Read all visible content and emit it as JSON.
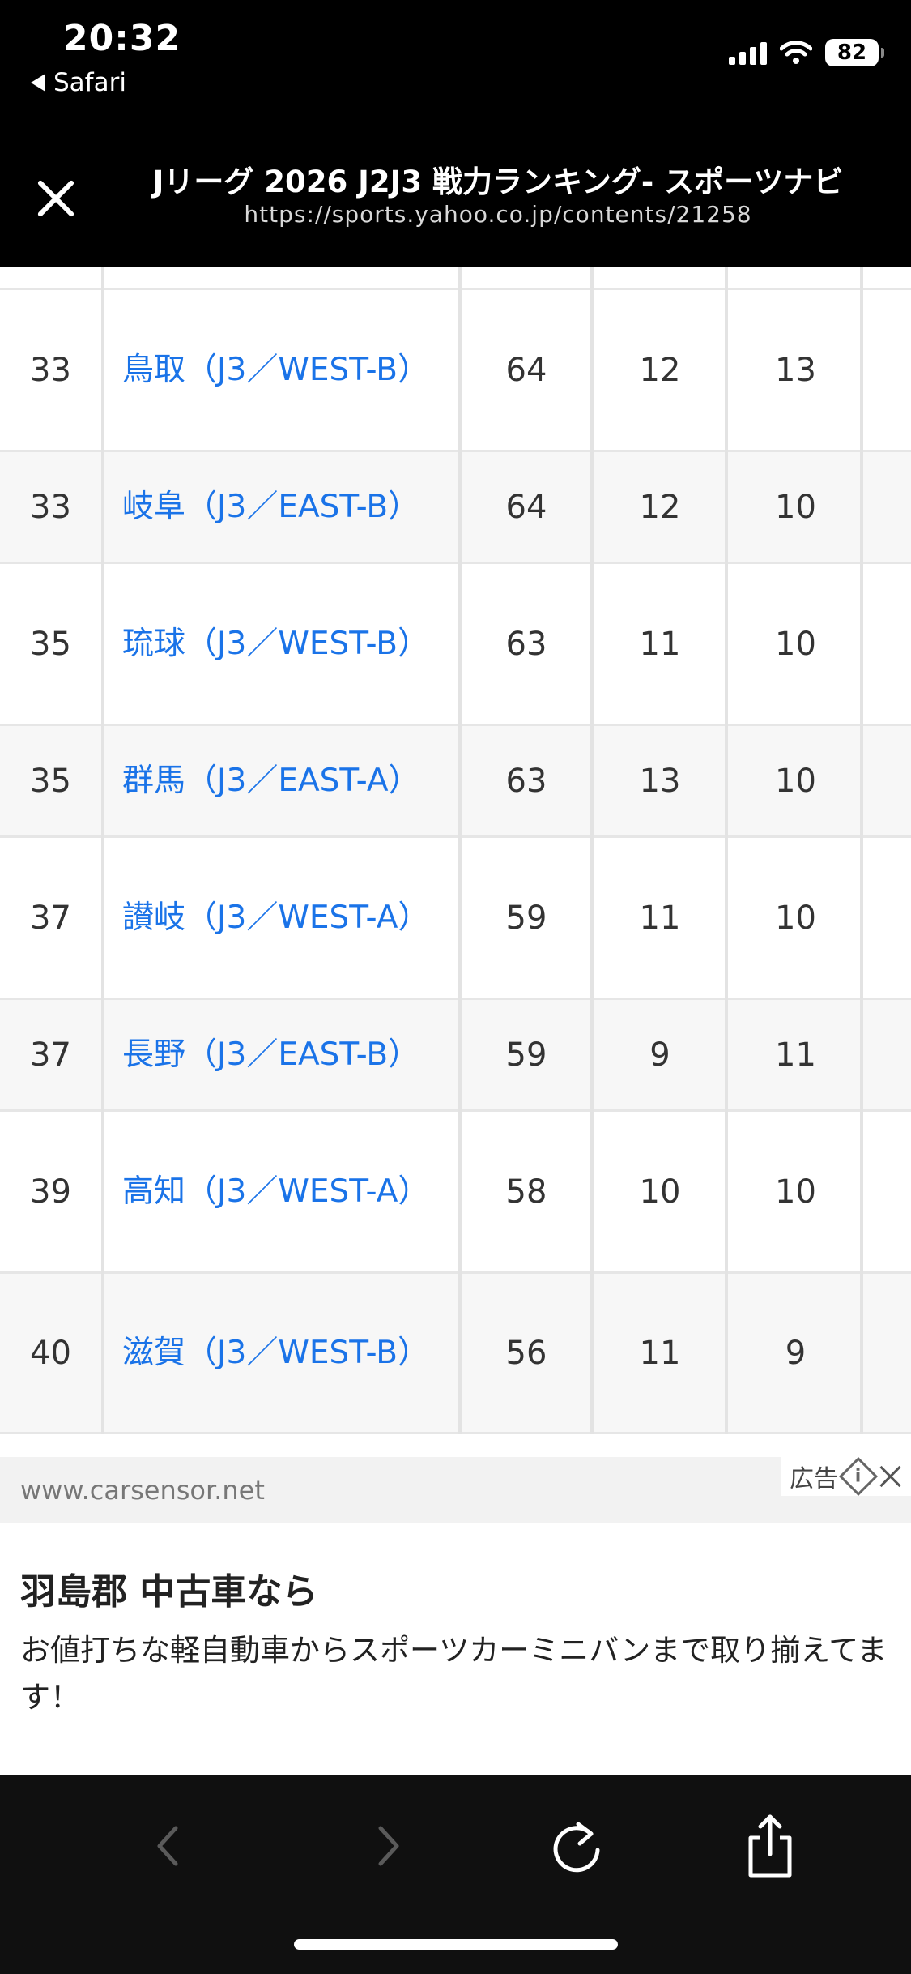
{
  "status_bar": {
    "time": "20:32",
    "back_app": "Safari",
    "battery": "82"
  },
  "header": {
    "title": "Jリーグ 2026 J2J3 戦力ランキング- スポーツナビ",
    "url": "https://sports.yahoo.co.jp/contents/21258"
  },
  "table": {
    "rows": [
      {
        "rank": "33",
        "team": "鳥取（J3／WEST-B）",
        "v1": "64",
        "v2": "12",
        "v3": "13"
      },
      {
        "rank": "33",
        "team": "岐阜（J3／EAST-B）",
        "v1": "64",
        "v2": "12",
        "v3": "10"
      },
      {
        "rank": "35",
        "team": "琉球（J3／WEST-B）",
        "v1": "63",
        "v2": "11",
        "v3": "10"
      },
      {
        "rank": "35",
        "team": "群馬（J3／EAST-A）",
        "v1": "63",
        "v2": "13",
        "v3": "10"
      },
      {
        "rank": "37",
        "team": "讃岐（J3／WEST-A）",
        "v1": "59",
        "v2": "11",
        "v3": "10"
      },
      {
        "rank": "37",
        "team": "長野（J3／EAST-B）",
        "v1": "59",
        "v2": "9",
        "v3": "11"
      },
      {
        "rank": "39",
        "team": "高知（J3／WEST-A）",
        "v1": "58",
        "v2": "10",
        "v3": "10"
      },
      {
        "rank": "40",
        "team": "滋賀（J3／WEST-B）",
        "v1": "56",
        "v2": "11",
        "v3": "9"
      }
    ]
  },
  "ad": {
    "domain": "www.carsensor.net",
    "badge": "広告",
    "headline": "羽島郡 中古車なら",
    "body": "お値打ちな軽自動車からスポーツカーミニバンまで取り揃えてます！"
  },
  "toolbar": {
    "icons": [
      "chevron-left-icon",
      "chevron-right-icon",
      "reload-icon",
      "share-icon"
    ]
  }
}
